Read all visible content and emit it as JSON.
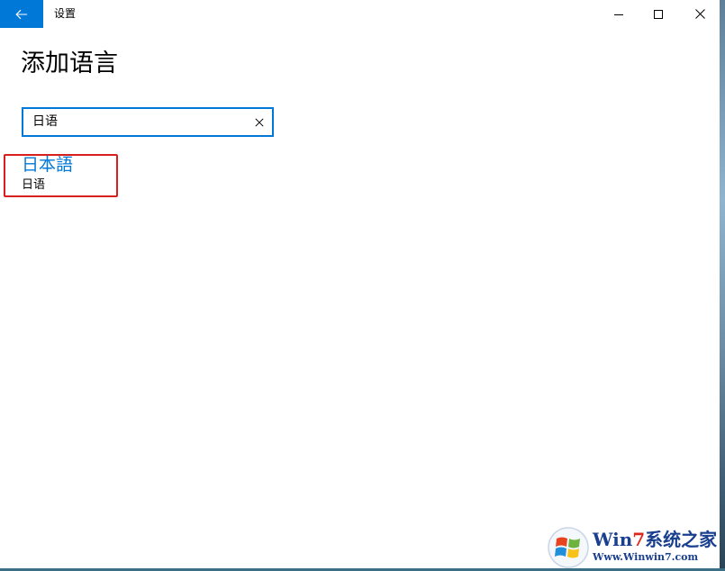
{
  "titlebar": {
    "app_title": "设置",
    "back_icon": "arrow-left-icon",
    "minimize_icon": "minimize-icon",
    "maximize_icon": "maximize-icon",
    "close_icon": "close-icon",
    "accent_color": "#0078d7"
  },
  "page": {
    "title": "添加语言"
  },
  "search": {
    "value": "日语",
    "placeholder": "",
    "clear_icon": "close-icon",
    "border_color": "#0078d7"
  },
  "results": [
    {
      "native_name": "日本語",
      "local_name": "日语"
    }
  ],
  "highlight": {
    "color": "#d91e1e"
  },
  "watermark": {
    "title_prefix": "Win",
    "title_digit": "7",
    "title_suffix": "系统之家",
    "url": "Www.Winwin7.com"
  }
}
